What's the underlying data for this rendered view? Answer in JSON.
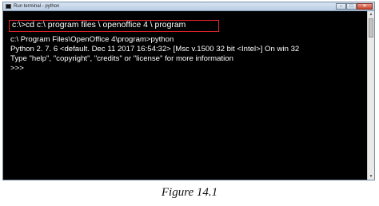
{
  "window": {
    "title": "Run terminal - python",
    "controls": {
      "minimize": "–",
      "maximize": "□",
      "close": "✕"
    }
  },
  "console": {
    "command": "c:\\>cd c:\\ program files \\ openoffice 4 \\ program",
    "lines": [
      "c:\\ Program Files\\OpenOffice 4\\program>python",
      "Python 2. 7. 6 <default. Dec 11 2017 16:54:32> [Msc v.1500 32 bit <Intel>] On win 32",
      "Type \"help\", \"copyright\", \"credits\" or \"license\" for more information",
      ">>>"
    ]
  },
  "scrollbar": {
    "up_arrow": "▲",
    "down_arrow": "▼"
  },
  "caption": "Figure 14.1"
}
